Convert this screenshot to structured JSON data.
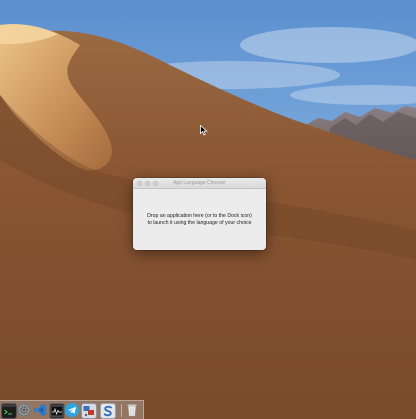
{
  "window": {
    "title": "App Language Chooser",
    "message_lines": [
      "Drop an application here (or to the Dock icon)",
      "to launch it using the language of your choice"
    ]
  },
  "dock": {
    "items": [
      {
        "icon": "terminal-icon",
        "color": "#1e1e1e"
      },
      {
        "icon": "system-preferences-icon",
        "color": "#8a8a8a"
      },
      {
        "icon": "visual-studio-code-icon",
        "color": "#2a7ccc"
      },
      {
        "icon": "activity-monitor-icon",
        "color": "#333333"
      },
      {
        "icon": "telegram-icon",
        "color": "#2ca5e0"
      },
      {
        "icon": "app-language-chooser-icon",
        "color": "#3d6fb6"
      },
      {
        "icon": "scrivener-s-icon",
        "color": "#2b6db8"
      },
      {
        "icon": "trash-icon",
        "color": "#d8d8d8"
      }
    ]
  },
  "colors": {
    "sky": "#6f9fd6",
    "dune": "#8a5a35",
    "window_bg": "#ececec"
  }
}
